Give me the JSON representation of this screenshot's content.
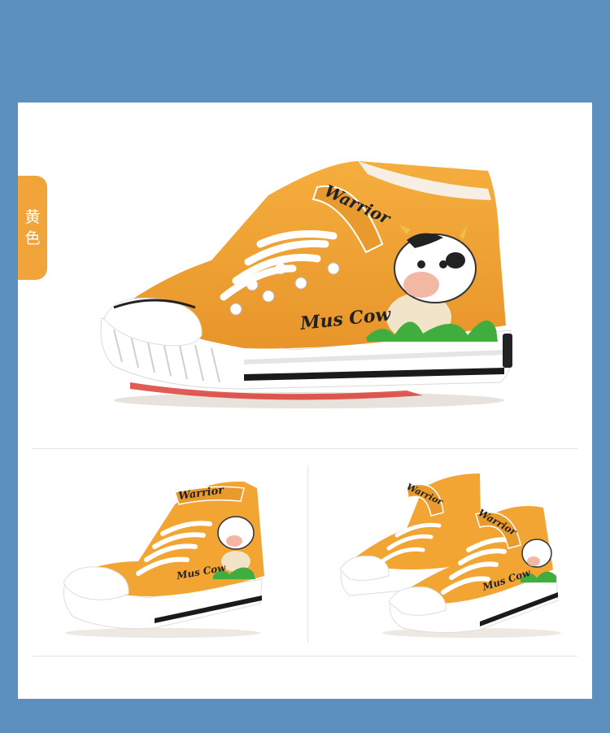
{
  "color_tab": {
    "line1": "黄",
    "line2": "色"
  },
  "shoe": {
    "tongue_text": "Warrior",
    "side_text": "Mus Cow"
  },
  "colors": {
    "background": "#5b8fbd",
    "panel": "#ffffff",
    "tab": "#f0a43a",
    "canvas": "#f2a533",
    "sole": "#ffffff",
    "stripe": "#1a1a1a"
  }
}
